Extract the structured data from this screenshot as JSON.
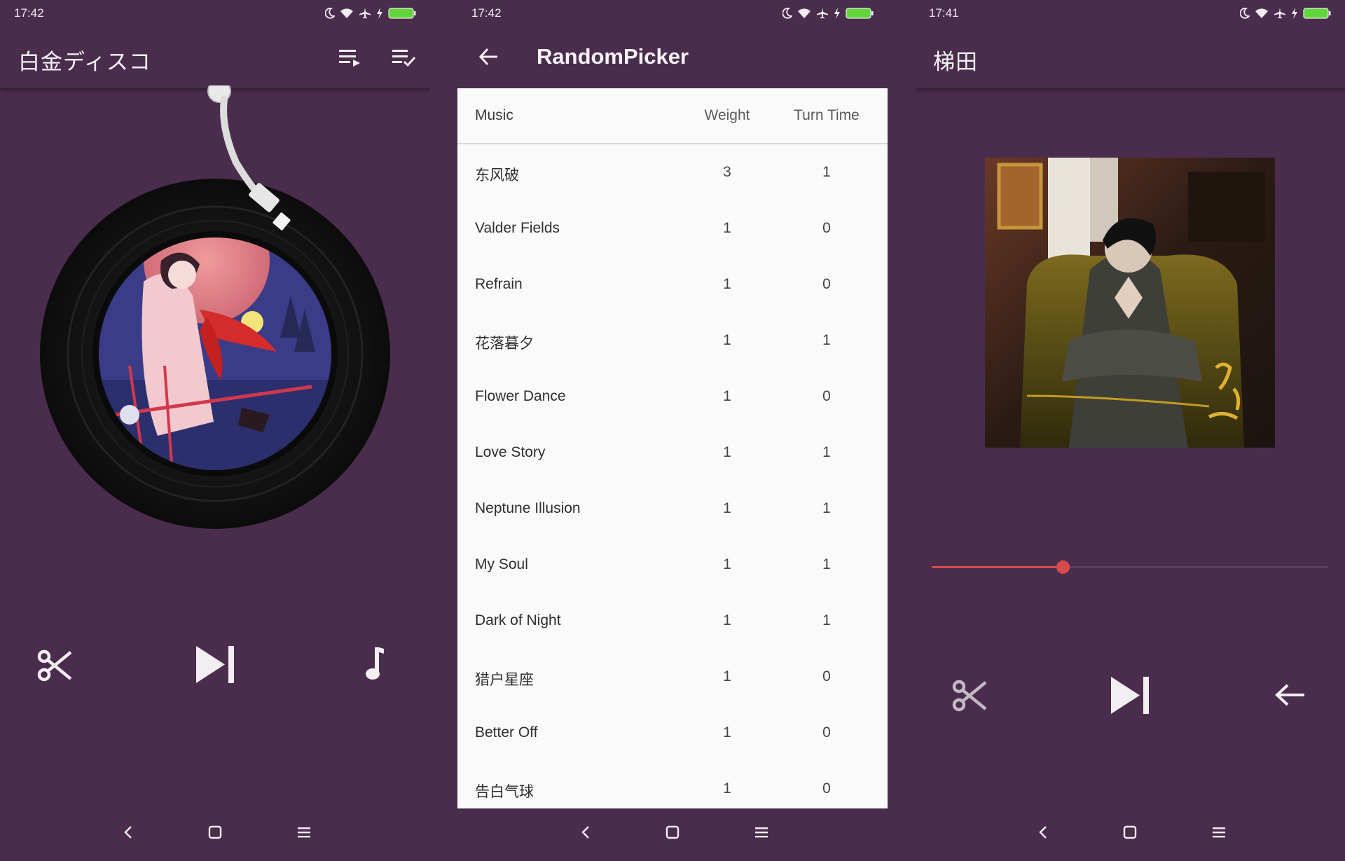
{
  "colors": {
    "background": "#4a2d4d",
    "accent": "#d84a4a",
    "icon": "#f2eef2",
    "table_bg": "#fafafa"
  },
  "panels": [
    {
      "status_time": "17:42",
      "app_title": "白金ディスコ",
      "actions": [
        "playlist-play-icon",
        "playlist-check-icon"
      ],
      "controls": [
        "scissors-icon",
        "skip-next-icon",
        "music-note-icon"
      ]
    },
    {
      "status_time": "17:42",
      "app_title": "RandomPicker",
      "table": {
        "headers": {
          "music": "Music",
          "weight": "Weight",
          "turn_time": "Turn Time"
        },
        "rows": [
          {
            "music": "东风破",
            "weight": "3",
            "turn_time": "1"
          },
          {
            "music": "Valder Fields",
            "weight": "1",
            "turn_time": "0"
          },
          {
            "music": "Refrain",
            "weight": "1",
            "turn_time": "0"
          },
          {
            "music": "花落暮夕",
            "weight": "1",
            "turn_time": "1"
          },
          {
            "music": "Flower Dance",
            "weight": "1",
            "turn_time": "0"
          },
          {
            "music": "Love Story",
            "weight": "1",
            "turn_time": "1"
          },
          {
            "music": "Neptune Illusion",
            "weight": "1",
            "turn_time": "1"
          },
          {
            "music": "My Soul",
            "weight": "1",
            "turn_time": "1"
          },
          {
            "music": "Dark of Night",
            "weight": "1",
            "turn_time": "1"
          },
          {
            "music": "猎户星座",
            "weight": "1",
            "turn_time": "0"
          },
          {
            "music": "Better Off",
            "weight": "1",
            "turn_time": "0"
          },
          {
            "music": "告白气球",
            "weight": "1",
            "turn_time": "0"
          }
        ]
      }
    },
    {
      "status_time": "17:41",
      "app_title": "梯田",
      "seek_progress": 0.33,
      "controls": [
        "scissors-icon",
        "skip-next-icon",
        "arrow-back-icon"
      ]
    }
  ],
  "status_icons": [
    "moon-icon",
    "wifi-icon",
    "airplane-icon",
    "charging-icon",
    "battery-icon"
  ],
  "nav_buttons": [
    "nav-back-icon",
    "nav-home-icon",
    "nav-menu-icon"
  ]
}
